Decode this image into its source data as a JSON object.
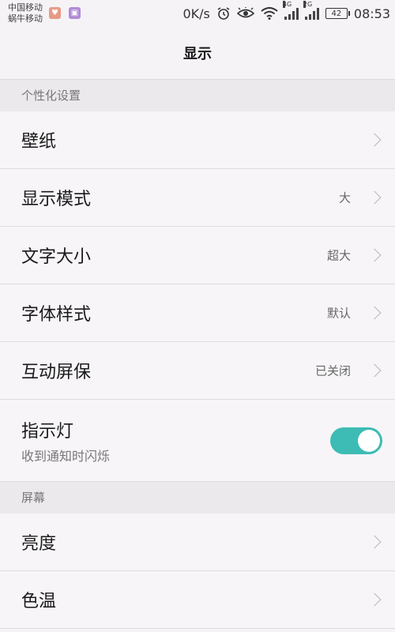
{
  "status_bar": {
    "carrier_1": "中国移动",
    "carrier_2": "蜗牛移动",
    "speed": "0K/s",
    "signal_1_tag": "4G",
    "signal_2_tag": "2G",
    "battery": "42",
    "time": "08:53"
  },
  "header": {
    "title": "显示"
  },
  "sections": {
    "personalization": {
      "title": "个性化设置",
      "items": [
        {
          "label": "壁纸",
          "value": ""
        },
        {
          "label": "显示模式",
          "value": "大"
        },
        {
          "label": "文字大小",
          "value": "超大"
        },
        {
          "label": "字体样式",
          "value": "默认"
        },
        {
          "label": "互动屏保",
          "value": "已关闭"
        }
      ],
      "indicator": {
        "label": "指示灯",
        "sublabel": "收到通知时闪烁",
        "enabled": true
      }
    },
    "screen": {
      "title": "屏幕",
      "items": [
        {
          "label": "亮度",
          "value": ""
        },
        {
          "label": "色温",
          "value": ""
        }
      ]
    }
  },
  "colors": {
    "toggle_on": "#3cbcb4",
    "background": "#f5f3f6"
  }
}
